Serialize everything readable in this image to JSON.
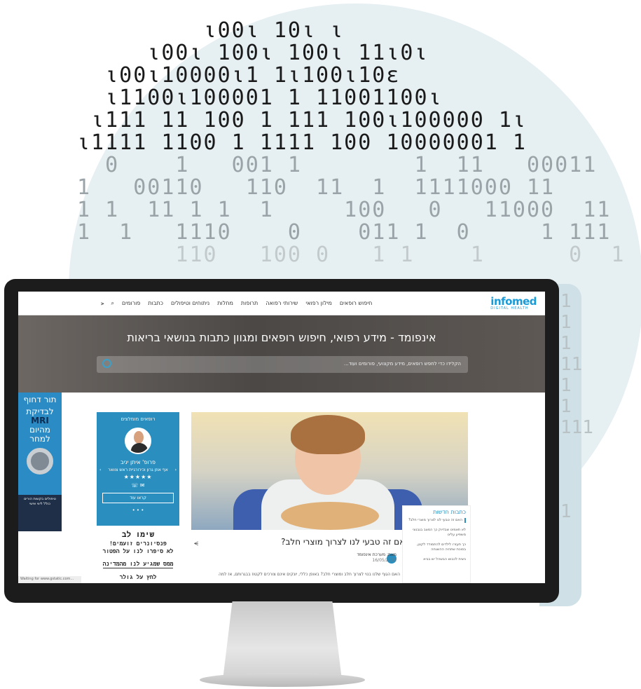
{
  "decor": {
    "binary_rows": [
      {
        "text": "         ι00ι 10ι ι",
        "tone": "dark"
      },
      {
        "text": "     ι00ι 100ι 100ι 11ι0ι",
        "tone": "dark"
      },
      {
        "text": "  ι00ι10000ι1 1ι100ι10ɛ",
        "tone": "dark"
      },
      {
        "text": "  ι1100ι100001 1 11001100ι",
        "tone": "dark"
      },
      {
        "text": " ι111 11 100 1 111 100ι100000 1ι",
        "tone": "dark"
      },
      {
        "text": "ι1111 1100 1 1111 100 10000001 1",
        "tone": "dark"
      },
      {
        "text": "  0    1   001 1        1  11   00011",
        "tone": "mid"
      },
      {
        "text": "1   00110   110  11  1  1111000 11",
        "tone": "mid"
      },
      {
        "text": "1 1  11 1 1  1     100   0   11000  11  1",
        "tone": "mid"
      },
      {
        "text": "1  1   1110    0    011 1  0     1 111",
        "tone": "mid"
      },
      {
        "text": "       110   100 0   1 1    1      0  1",
        "tone": "light"
      }
    ],
    "side_binary": [
      "1",
      "1",
      "1",
      "11",
      "1",
      "1",
      "111",
      "",
      "",
      "",
      "1"
    ]
  },
  "header": {
    "logo_main": "infomed",
    "logo_sub": "DIGITAL HEALTH",
    "nav": [
      "חיפוש רופאים",
      "מילון רפואי",
      "שירותי רפואה",
      "תרופות",
      "מחלות",
      "ניתוחים וטיפולים",
      "כתבות",
      "פורומים"
    ],
    "search_icon": "search-icon",
    "share_icon": "share-icon"
  },
  "hero": {
    "title": "אינפומד - מידע רפואי, חיפוש רופאים ומגוון כתבות בנושאי בריאות",
    "search_placeholder": "הקלידו כדי לחפש רופאים, מידע מקצועי, פורומים ועוד..."
  },
  "side_ad": {
    "line1": "תור דחוף",
    "line2": "לבדיקת",
    "line3": "MRI",
    "line4": "מהיום",
    "line5": "למחר",
    "footer": "טיפולים בקשות הורים כולל ליווי אישי"
  },
  "recommended": {
    "heading": "רופאים מומלצים",
    "doctor_name": "פרופ' איתן יניב",
    "specialty": "אף אוזן גרון וכירורגיית ראש צוואר",
    "stars": "★★★★★",
    "button": "קראו עוד",
    "dots": "• • •"
  },
  "text_ad": {
    "title": "שימו לב",
    "line1": "פנסיונרים זועמים!",
    "line2": "לא סיפרו לנו על הפטור",
    "line3": "ממס שמגיע לנו מהמדינה",
    "line4": "לחץ על גולר"
  },
  "status_bar": "Waiting for www.gstatic.com...",
  "article": {
    "title": "האם זה טבעי לנו לצרוך מוצרי חלב?",
    "author": "מאת: מערכת אינפומד",
    "date": "16/05/2021",
    "excerpt": "האם הגוף שלנו בנוי לצרוך חלב ומוצרי חלב? באופן כללי, יונקים אינם צורכים לקטוז בבגרותם, אז למה"
  },
  "news": {
    "heading": "כתבות חדשות",
    "items": [
      "האם זה טבעי לנו לצרוך מוצרי חלב?",
      "לא תאמינו שבדיוק כך המצב בגבנוני משפיע עלינו",
      "כך תעזרו לילדים להתמודד לקטן, בסוכת שתהיה ההשגחה",
      "ניצית לכבוש הבשהל יש בביא"
    ]
  },
  "colors": {
    "accent": "#2a8fbf",
    "logo": "#1a9bd7",
    "bg_circle": "#e6eff2",
    "monitor": "#1c1c1c"
  }
}
